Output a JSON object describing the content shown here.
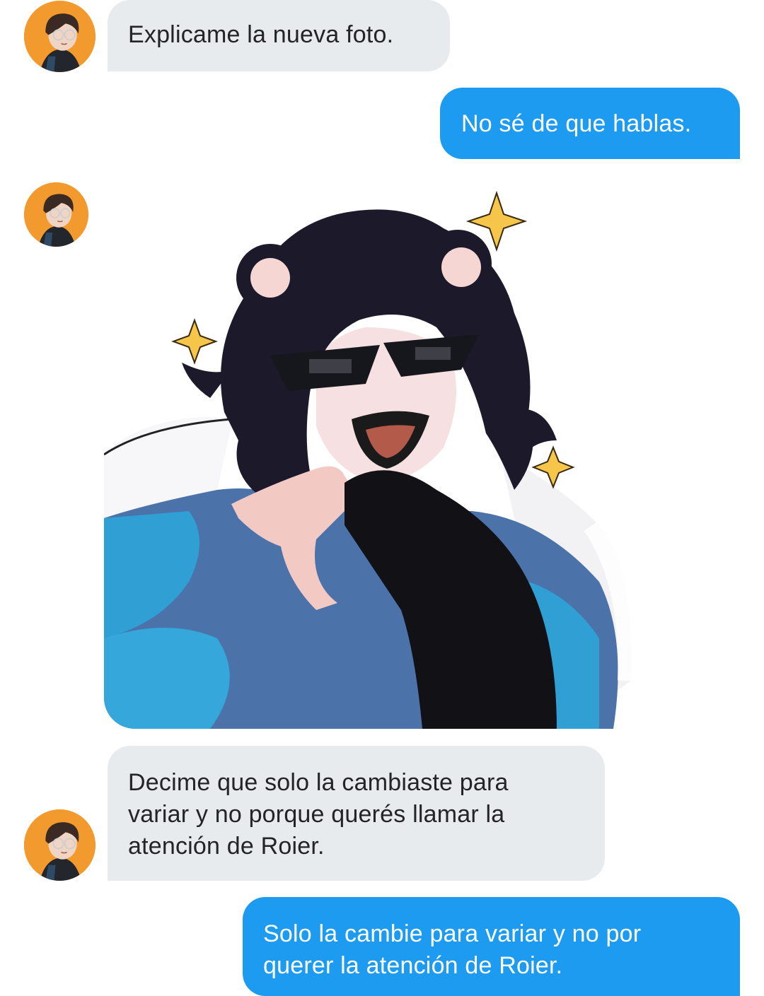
{
  "conversation": {
    "messages": [
      {
        "id": "m1",
        "direction": "received",
        "lines": [
          "Explicame la nueva foto."
        ]
      },
      {
        "id": "m2",
        "direction": "sent",
        "lines": [
          "No sé de que hablas."
        ]
      },
      {
        "id": "m3",
        "direction": "received",
        "type": "image",
        "image_description_icon": "anime-character-sunglasses-image"
      },
      {
        "id": "m4",
        "direction": "received",
        "lines": [
          "Decime que solo la cambiaste para",
          "variar y no porque querés llamar la",
          "atención de Roier."
        ]
      },
      {
        "id": "m5",
        "direction": "sent",
        "lines": [
          "Solo la cambie para variar y no por",
          "querer la atención de Roier."
        ]
      }
    ]
  },
  "colors": {
    "sent_bubble": "#1d9bf0",
    "received_bubble": "#e8ebee",
    "avatar_background": "#f29a2e"
  }
}
